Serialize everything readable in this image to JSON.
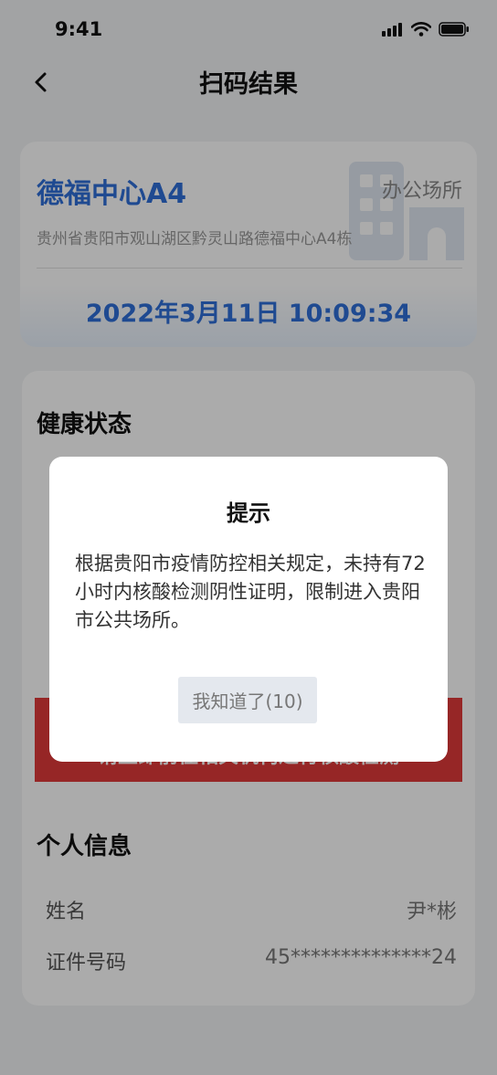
{
  "status_bar": {
    "time": "9:41"
  },
  "nav": {
    "title": "扫码结果"
  },
  "place": {
    "name": "德福中心A4",
    "type": "办公场所",
    "address": "贵州省贵阳市观山湖区黔灵山路德福中心A4栋",
    "scan_time": "2022年3月11日 10:09:34"
  },
  "health": {
    "title": "健康状态",
    "alert_text": "请立即前往相关机构进行核酸检测"
  },
  "personal": {
    "title": "个人信息",
    "fields": [
      {
        "label": "姓名",
        "value": "尹*彬"
      },
      {
        "label": "证件号码",
        "value": "45**************24"
      }
    ]
  },
  "dialog": {
    "title": "提示",
    "message": "根据贵阳市疫情防控相关规定，未持有72小时内核酸检测阴性证明，限制进入贵阳市公共场所。",
    "button_label": "我知道了(10)"
  },
  "colors": {
    "accent_blue": "#2f6fd8",
    "alert_red": "#e03a3a"
  },
  "icons": [
    "signal-icon",
    "wifi-icon",
    "battery-icon",
    "back-arrow-icon",
    "building-icon"
  ]
}
